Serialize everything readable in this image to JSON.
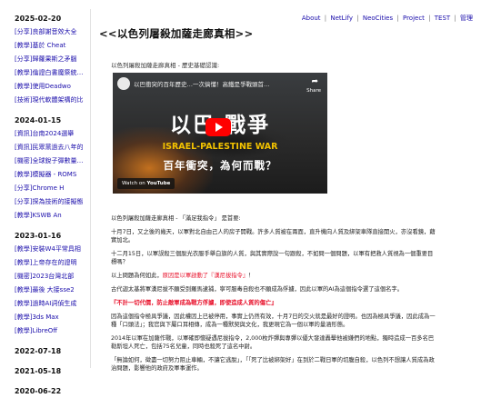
{
  "sidebar": [
    {
      "date": "2025-02-20",
      "posts": [
        "[分享]良部謝音效大全",
        "[教學]基於 Cheat",
        "[分享]歸蘿果斯之矛腦",
        "[教學]倫證白書魔祭統…",
        "[教學]使用Deadwo",
        "[技術]現代軟體架構的比"
      ]
    },
    {
      "date": "2024-01-15",
      "posts": [
        "[資訊]台南2024選舉",
        "[資訊]民眾黨過去八年的",
        "[機密]全球銳子彈數量…",
        "[教學]模擬器 - ROMS",
        "[分享]Chrome H",
        "[分享]探為技術的接擬態",
        "[教學]KSWB An"
      ]
    },
    {
      "date": "2023-01-16",
      "posts": [
        "[教學]安裝W4平常具相",
        "[教學]上帝存在的證明",
        "[機密]2023台灣北部",
        "[教學]最後 大接sse2",
        "[教學]過時AI詞偵生成",
        "[教學]3ds Max",
        "[教學]LibreOff"
      ]
    },
    {
      "date": "2022-07-18",
      "posts": []
    },
    {
      "date": "2021-05-18",
      "posts": []
    },
    {
      "date": "2020-06-22",
      "posts": []
    }
  ],
  "nav": {
    "links": [
      "About",
      "NetLify",
      "NeoCities",
      "Project",
      "TEST"
    ],
    "admin": "管理"
  },
  "page_title": "<<以色列屠殺加薩走廊真相>>",
  "breadcrumb": "以色列屠殺加薩走廊真相 - 歷史基礎認識:",
  "video": {
    "channel_title": "以巴衝突的百年歷史…一次搞懂！高鐵是爭戰頭首…",
    "share": "Share",
    "headline": "以巴 戰爭",
    "subheadline": "ISRAEL-PALESTINE WAR",
    "tagline": "百年衝突，為何而戰？",
    "watch_prefix": "Watch on",
    "watch_brand": "YouTube"
  },
  "article": {
    "p1": "以色列屠殺加薩走廊真相 - 「滿足我指令」 是首要:",
    "p2": "十月7日，又之後的幾天，以軍對北自由己人的房子開戰。許多人質被在兩面，直升機向人質及綁架車隊直接開火，亦沒看鏡，藉實加北。",
    "p3": "十二月15日，以軍誤殺三個脫光衣服手舉白旗的人質，與其實際說一句跟殺，不如問一個問題，以軍有把救人質視為一個重要目標嗎？",
    "p4_prefix": "以上問題為何如此，",
    "p4_highlight": "原因是以軍啟動了『漢尼拔指令』",
    "p4_suffix": "！",
    "p5": "古代迦太基將軍漢尼拔不願受到羅馬逮捕，寧可服毒自殺也不願成為俘擄，因此以軍的AI為這個指令選了這個名字。",
    "p6": "『不計一切代價，防止敵軍成為戰方俘擄，即使造成人質的傷亡』",
    "p7": "因為這個指令極具爭議，因此權因上已被停用，事實上仍然有效，十月7日的交火就是最好的證明。也因為極具爭議，因此成為一種「口頭法」；我官與下屬口耳相傳，成為一種默契與文化，我更現它為一個以軍的量涵形態。",
    "p8": "2014年以軍在加薩作戰，以軍確即懷疑遇尼拔指令，2,000枚炸彈與專彈以優大發達轟擊他被嫌們的地點，獨時造成一百多名巴勒斯坦人死亡，包括75名兒童，同時也殺死了這名中尉。",
    "p9": "「無論如何，徵盡一切努力阻止車輛，不讓它逃脫」，「「死了比被綁架好」在到於二戰日軍的切腹自殺，以色列不想讓人質成為政治問題，影響他的政府及軍事運作。"
  }
}
